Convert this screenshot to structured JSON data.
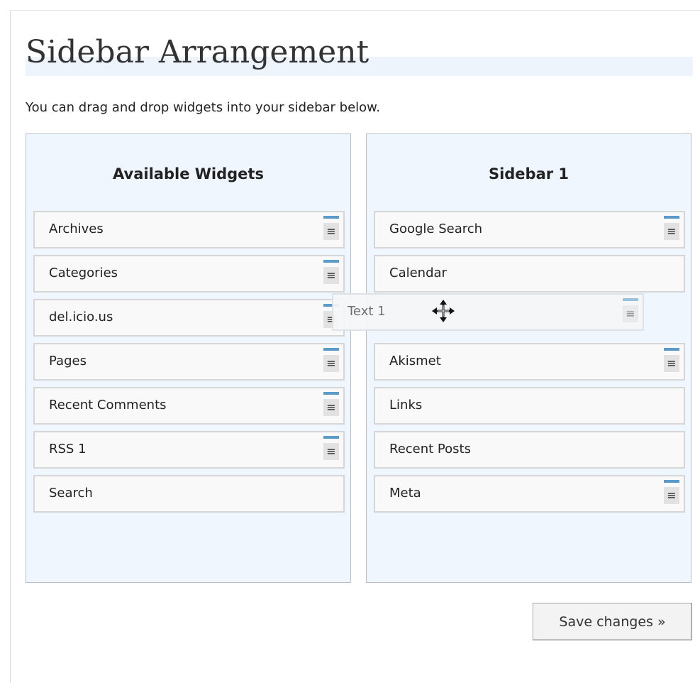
{
  "page": {
    "title": "Sidebar Arrangement",
    "intro": "You can drag and drop widgets into your sidebar below."
  },
  "available": {
    "heading": "Available Widgets",
    "items": [
      {
        "label": "Archives",
        "has_handle": true
      },
      {
        "label": "Categories",
        "has_handle": true
      },
      {
        "label": "del.icio.us",
        "has_handle": true
      },
      {
        "label": "Pages",
        "has_handle": true
      },
      {
        "label": "Recent Comments",
        "has_handle": true
      },
      {
        "label": "RSS 1",
        "has_handle": true
      },
      {
        "label": "Search",
        "has_handle": false
      }
    ]
  },
  "sidebar": {
    "heading": "Sidebar 1",
    "items": [
      {
        "label": "Google Search",
        "has_handle": true
      },
      {
        "label": "Calendar",
        "has_handle": false
      },
      {
        "label": "",
        "has_handle": false
      },
      {
        "label": "Akismet",
        "has_handle": true
      },
      {
        "label": "Links",
        "has_handle": false
      },
      {
        "label": "Recent Posts",
        "has_handle": false
      },
      {
        "label": "Meta",
        "has_handle": true
      }
    ]
  },
  "dragging": {
    "label": "Text 1",
    "has_handle": true
  },
  "actions": {
    "save_label": "Save changes »"
  },
  "icons": {
    "handle": "≡",
    "cursor": "move-cursor-icon"
  },
  "colors": {
    "panel_bg": "#eff6fe",
    "handle_accent": "#5a9bc9"
  }
}
